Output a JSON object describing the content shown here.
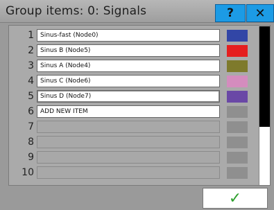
{
  "window": {
    "title": "Group items: 0: Signals",
    "help_label": "?",
    "close_label": "✕"
  },
  "items": [
    {
      "index": "1",
      "name": "Sinus-fast (Node0)",
      "color": "#3246a6"
    },
    {
      "index": "2",
      "name": "Sinus B (Node5)",
      "color": "#e51e1e"
    },
    {
      "index": "3",
      "name": "Sinus A (Node4)",
      "color": "#7e7a2c"
    },
    {
      "index": "4",
      "name": "Sinus C (Node6)",
      "color": "#d48cbe"
    },
    {
      "index": "5",
      "name": "Sinus D (Node7)",
      "color": "#6a48a6"
    },
    {
      "index": "6",
      "name": "ADD NEW ITEM",
      "color": null
    },
    {
      "index": "7",
      "name": "",
      "color": null
    },
    {
      "index": "8",
      "name": "",
      "color": null
    },
    {
      "index": "9",
      "name": "",
      "color": null
    },
    {
      "index": "10",
      "name": "",
      "color": null
    }
  ],
  "footer": {
    "ok_label": "✓"
  }
}
